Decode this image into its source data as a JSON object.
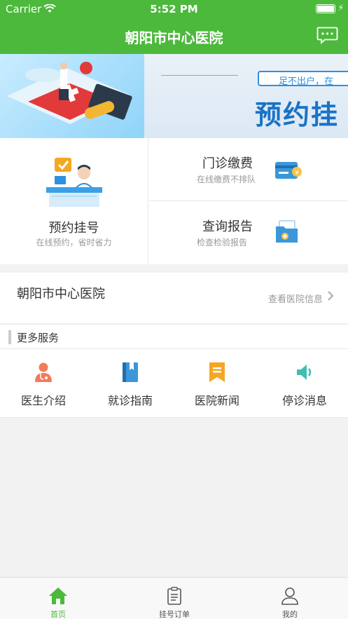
{
  "status_bar": {
    "carrier": "Carrier",
    "time": "5:52 PM"
  },
  "nav": {
    "title": "朝阳市中心医院",
    "message_icon": "chat-bubble-icon"
  },
  "banner": {
    "slogan": "足不出户，在",
    "headline": "预约挂",
    "slides": 3,
    "active_slide": 2
  },
  "cards": {
    "appointment": {
      "title": "预约挂号",
      "subtitle": "在线预约，省时省力",
      "icon": "doctor-desk-icon"
    },
    "payment": {
      "title": "门诊缴费",
      "subtitle": "在线缴费不排队",
      "icon": "payment-card-icon"
    },
    "report": {
      "title": "查询报告",
      "subtitle": "检查检验报告",
      "icon": "report-folder-icon"
    }
  },
  "hospital": {
    "name": "朝阳市中心医院",
    "link": "查看医院信息"
  },
  "more_services": {
    "heading": "更多服务",
    "items": [
      {
        "label": "医生介绍",
        "icon": "doctor-icon",
        "color": "#f07c5a"
      },
      {
        "label": "就诊指南",
        "icon": "guide-book-icon",
        "color": "#3a97d9"
      },
      {
        "label": "医院新闻",
        "icon": "news-bookmark-icon",
        "color": "#f5a623"
      },
      {
        "label": "停诊消息",
        "icon": "speaker-icon",
        "color": "#3dbfb2"
      }
    ]
  },
  "tabbar": {
    "items": [
      {
        "label": "首页",
        "icon": "home-icon",
        "active": true
      },
      {
        "label": "挂号订单",
        "icon": "clipboard-icon",
        "active": false
      },
      {
        "label": "我的",
        "icon": "user-icon",
        "active": false
      }
    ]
  },
  "colors": {
    "primary": "#4cb93c",
    "text": "#333333",
    "muted": "#999999"
  }
}
